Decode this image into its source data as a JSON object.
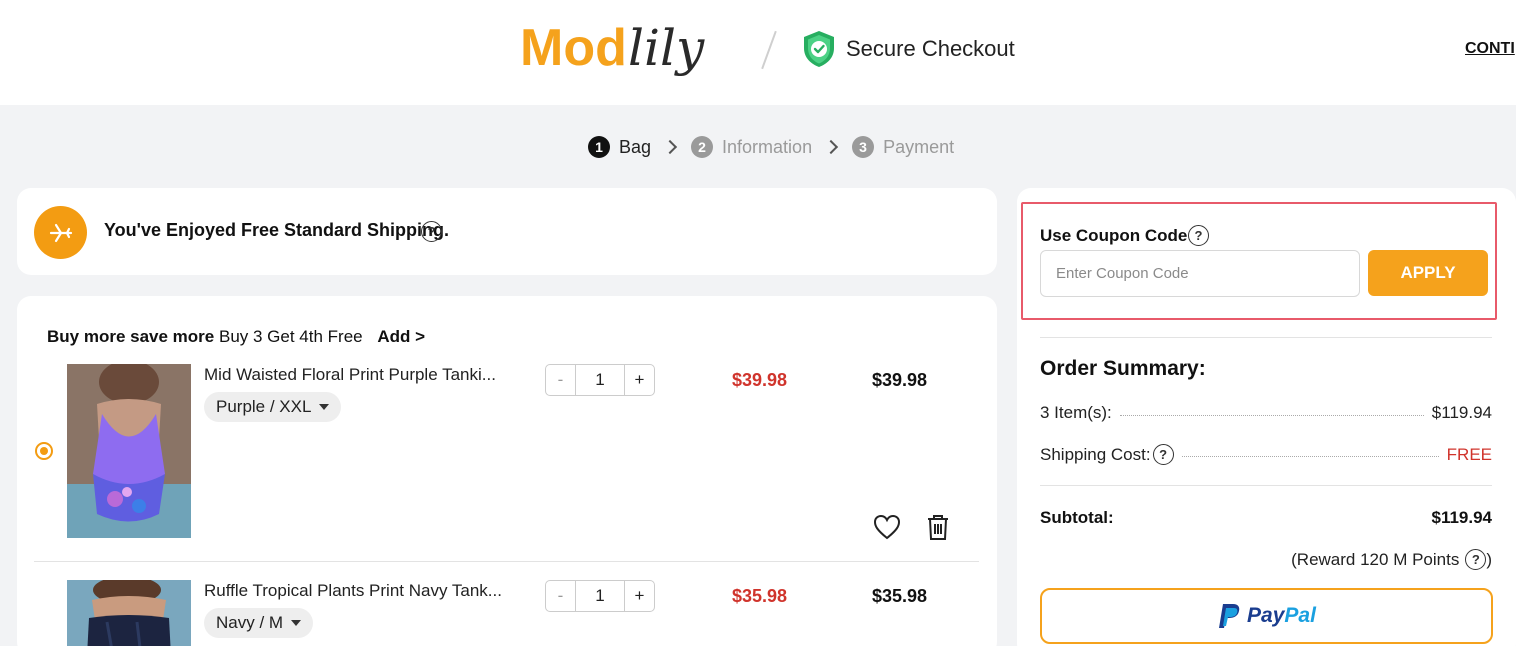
{
  "header": {
    "logo_text": "Modlily",
    "secure_checkout": "Secure Checkout",
    "continue_link": "CONTI"
  },
  "steps": [
    {
      "num": "1",
      "label": "Bag",
      "active": true
    },
    {
      "num": "2",
      "label": "Information",
      "active": false
    },
    {
      "num": "3",
      "label": "Payment",
      "active": false
    }
  ],
  "shipping": {
    "message": "You've Enjoyed Free Standard Shipping.",
    "help": "?"
  },
  "cart": {
    "promo_bold": "Buy more save more",
    "promo_text": "Buy 3 Get 4th Free",
    "promo_add": "Add >",
    "items": [
      {
        "title": "Mid Waisted Floral Print Purple Tanki...",
        "variant": "Purple / XXL",
        "qty_minus": "-",
        "qty": "1",
        "qty_plus": "+",
        "price": "$39.98",
        "total": "$39.98"
      },
      {
        "title": "Ruffle Tropical Plants Print Navy Tank...",
        "variant": "Navy / M",
        "qty_minus": "-",
        "qty": "1",
        "qty_plus": "+",
        "price": "$35.98",
        "total": "$35.98"
      }
    ]
  },
  "coupon": {
    "label": "Use Coupon Code",
    "help": "?",
    "placeholder": "Enter Coupon Code",
    "apply_label": "APPLY"
  },
  "summary": {
    "title": "Order Summary:",
    "items_label": "3 Item(s):",
    "items_value": "$119.94",
    "shipping_label": "Shipping Cost:",
    "shipping_value": "FREE",
    "subtotal_label": "Subtotal:",
    "subtotal_value": "$119.94",
    "reward_text": "(Reward 120 M Points",
    "reward_close": ")",
    "help": "?"
  },
  "paypal": {
    "pay": "Pay",
    "pal": "Pal"
  },
  "colors": {
    "accent": "#f5a21c",
    "sale_red": "#d0342c",
    "coupon_border": "#e85a6a",
    "shield_green": "#27ae60"
  }
}
